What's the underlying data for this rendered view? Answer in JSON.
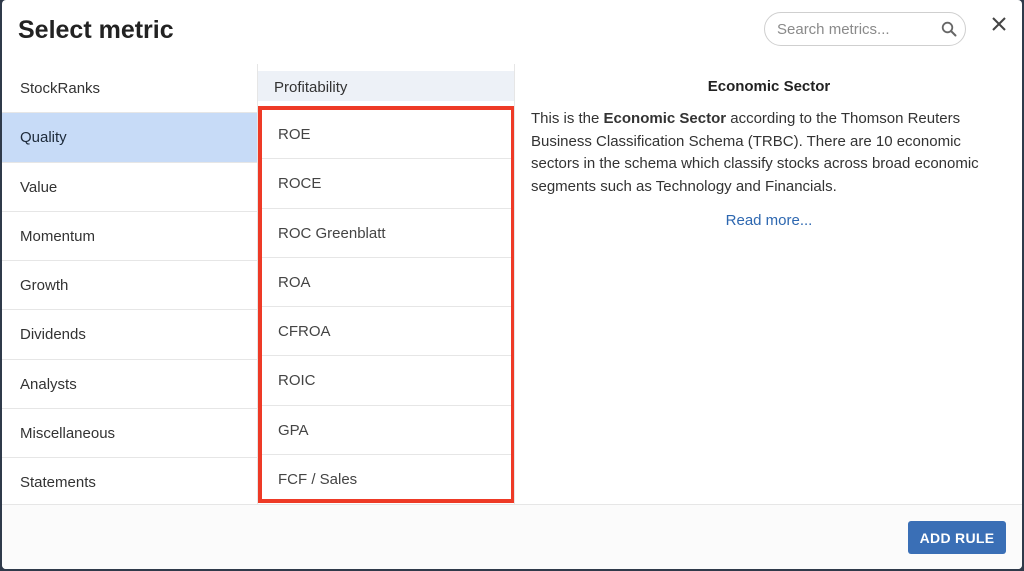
{
  "dialog": {
    "title": "Select metric",
    "search": {
      "placeholder": "Search metrics..."
    },
    "close_icon": "close-icon",
    "search_icon": "search-icon"
  },
  "sidebar": {
    "active_index": 1,
    "items": [
      {
        "label": "StockRanks"
      },
      {
        "label": "Quality"
      },
      {
        "label": "Value"
      },
      {
        "label": "Momentum"
      },
      {
        "label": "Growth"
      },
      {
        "label": "Dividends"
      },
      {
        "label": "Analysts"
      },
      {
        "label": "Miscellaneous"
      },
      {
        "label": "Statements"
      }
    ]
  },
  "metrics": {
    "category": "Profitability",
    "items": [
      {
        "label": "ROE"
      },
      {
        "label": "ROCE"
      },
      {
        "label": "ROC Greenblatt"
      },
      {
        "label": "ROA"
      },
      {
        "label": "CFROA"
      },
      {
        "label": "ROIC"
      },
      {
        "label": "GPA"
      },
      {
        "label": "FCF / Sales"
      }
    ],
    "highlight_color": "#ee3a26"
  },
  "description": {
    "title": "Economic Sector",
    "text_before": "This is the ",
    "text_bold": "Economic Sector",
    "text_after": " according to the Thomson Reuters Business Classification Schema (TRBC). There are 10 economic sectors in the schema which classify stocks across broad economic segments such as Technology and Financials.",
    "read_more": "Read more..."
  },
  "footer": {
    "add_rule_label": "ADD RULE",
    "accent": "#3a6fb6"
  }
}
